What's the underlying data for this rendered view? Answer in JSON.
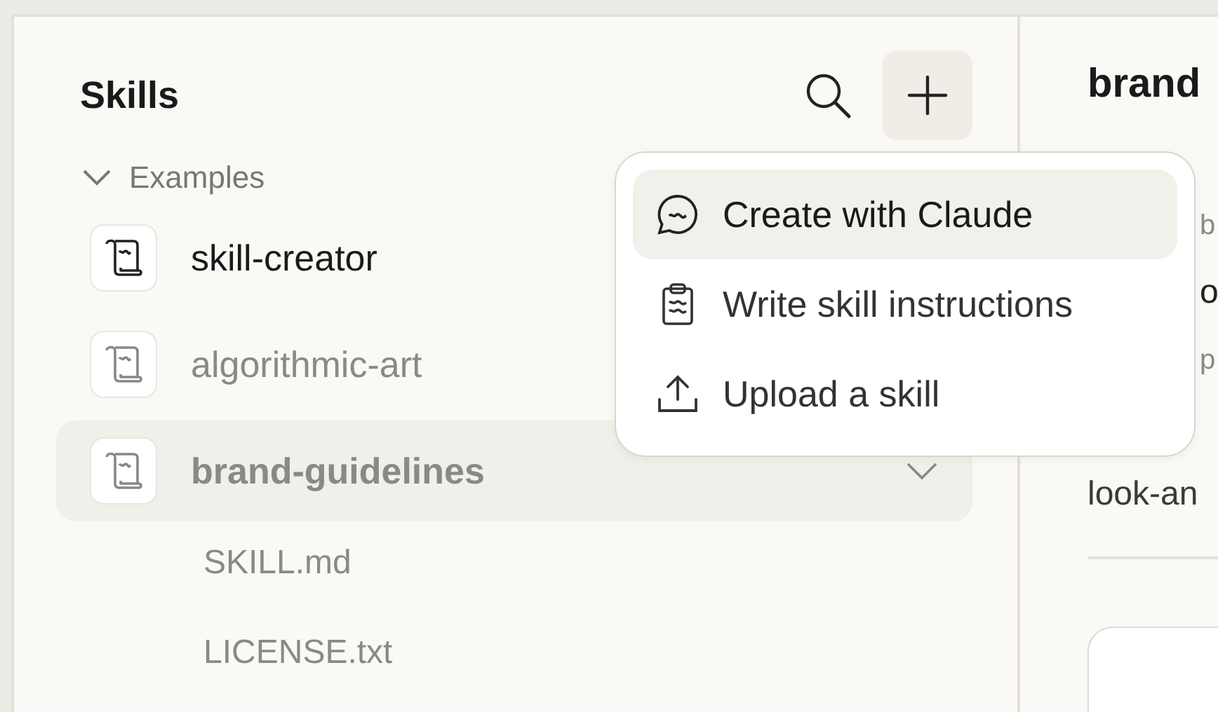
{
  "sidebar": {
    "title": "Skills",
    "add_button_active": true,
    "groups": [
      {
        "label": "Examples",
        "expanded": true,
        "items": [
          {
            "name": "skill-creator",
            "enabled": true,
            "selected": false
          },
          {
            "name": "algorithmic-art",
            "enabled": false,
            "selected": false
          },
          {
            "name": "brand-guidelines",
            "enabled": false,
            "selected": true,
            "expanded": true,
            "children": [
              {
                "name": "SKILL.md"
              },
              {
                "name": "LICENSE.txt"
              }
            ]
          }
        ]
      }
    ]
  },
  "add_menu": {
    "items": [
      {
        "kind": "chat",
        "label": "Create with Claude",
        "selected": true
      },
      {
        "kind": "clipboard",
        "label": "Write skill instructions",
        "selected": false
      },
      {
        "kind": "upload",
        "label": "Upload a skill",
        "selected": false
      }
    ]
  },
  "detail": {
    "title": "brand",
    "lines": [
      {
        "kind": "label",
        "text": "b"
      },
      {
        "kind": "value",
        "text": "o"
      },
      {
        "kind": "label",
        "text": "p"
      },
      {
        "kind": "body",
        "text": "look-an"
      }
    ]
  }
}
